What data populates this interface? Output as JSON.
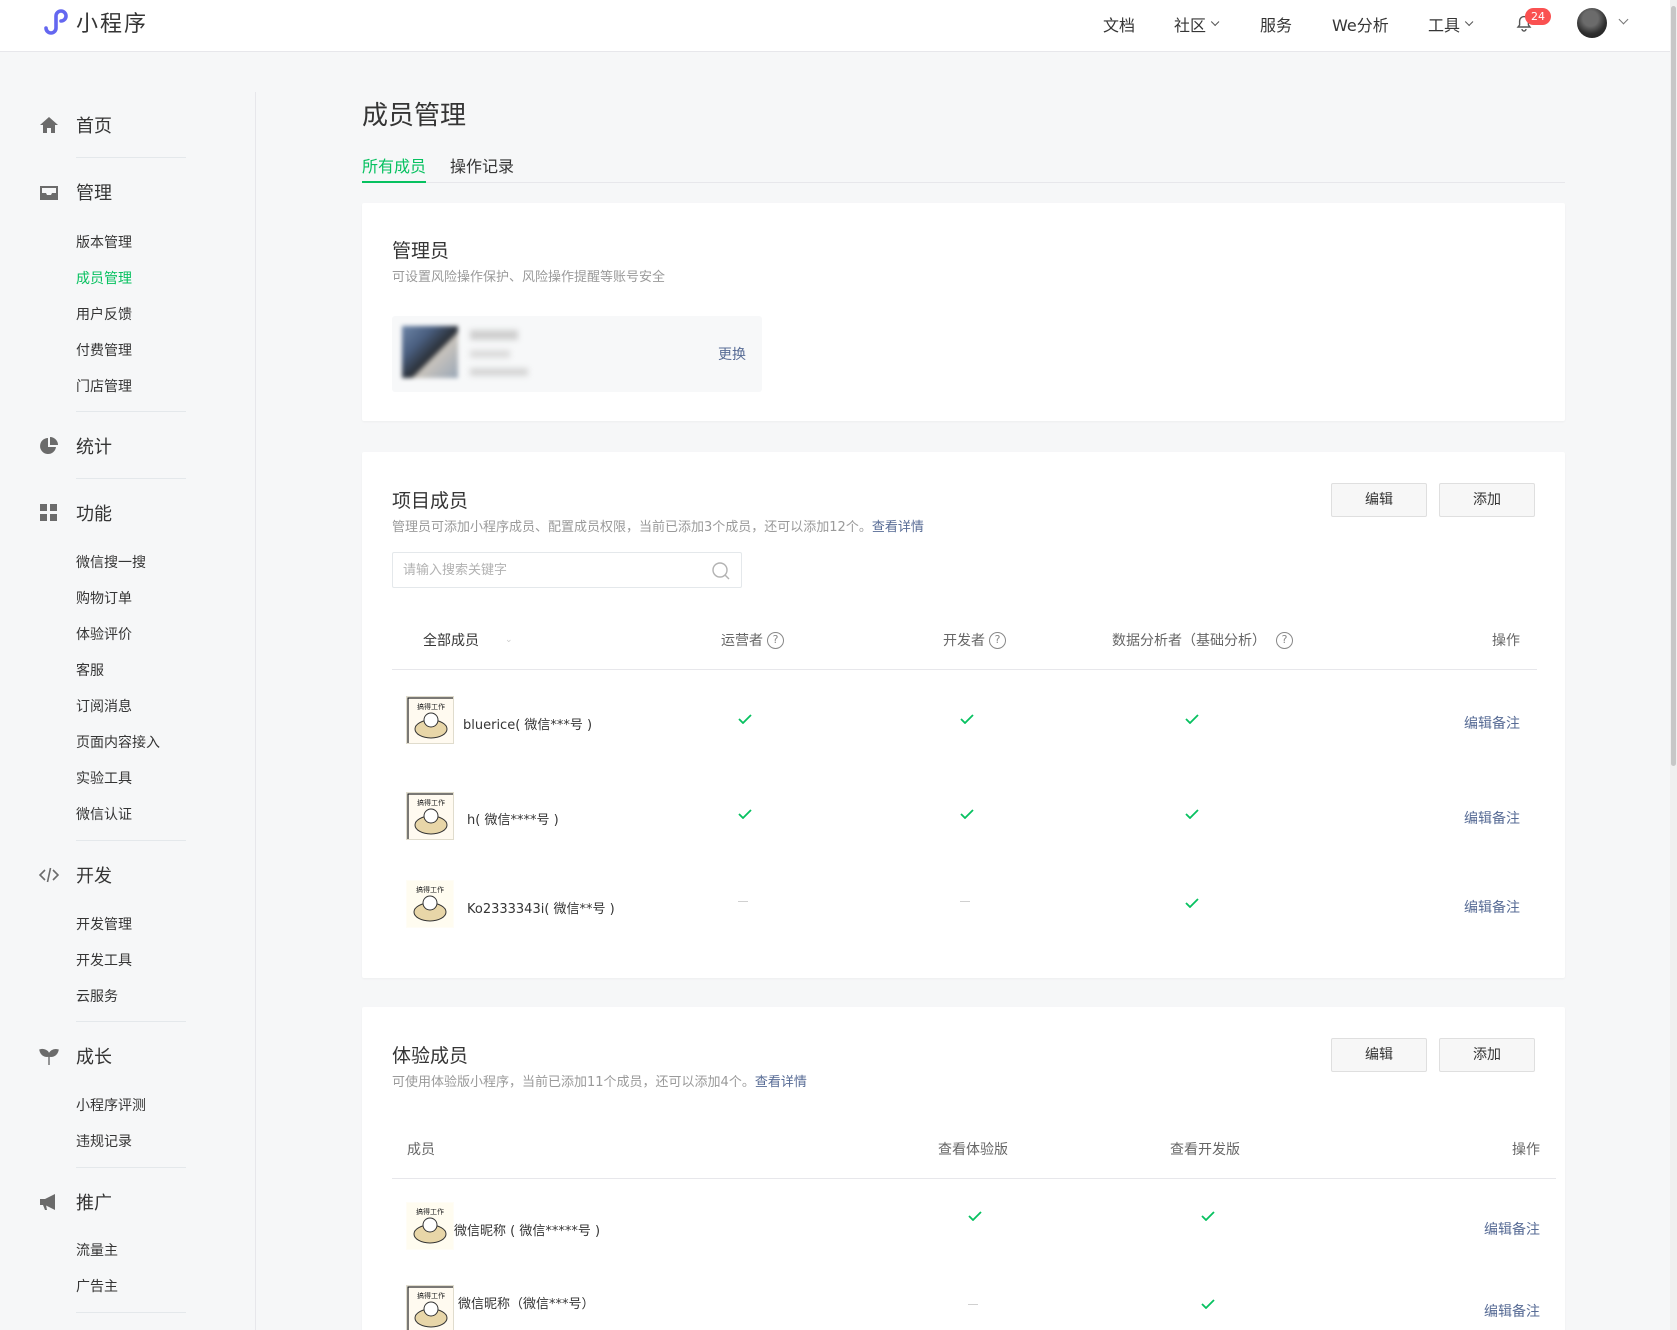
{
  "topbar": {
    "logo_text": "小程序",
    "nav": [
      {
        "label": "文档"
      },
      {
        "label": "社区"
      },
      {
        "label": "服务"
      },
      {
        "label": "We分析"
      },
      {
        "label": "工具"
      }
    ],
    "notification_count": "24"
  },
  "sidebar": {
    "sections": [
      {
        "label": "首页",
        "icon": "home-icon",
        "items": []
      },
      {
        "label": "管理",
        "icon": "inbox-icon",
        "items": [
          "版本管理",
          "成员管理",
          "用户反馈",
          "付费管理",
          "门店管理"
        ]
      },
      {
        "label": "统计",
        "icon": "pie-chart-icon",
        "items": []
      },
      {
        "label": "功能",
        "icon": "grid-icon",
        "items": [
          "微信搜一搜",
          "购物订单",
          "体验评价",
          "客服",
          "订阅消息",
          "页面内容接入",
          "实验工具",
          "微信认证"
        ]
      },
      {
        "label": "开发",
        "icon": "code-icon",
        "items": [
          "开发管理",
          "开发工具",
          "云服务"
        ]
      },
      {
        "label": "成长",
        "icon": "sprout-icon",
        "items": [
          "小程序评测",
          "违规记录"
        ]
      },
      {
        "label": "推广",
        "icon": "megaphone-icon",
        "items": [
          "流量主",
          "广告主"
        ]
      }
    ],
    "active_item": "成员管理"
  },
  "main": {
    "title": "成员管理",
    "tabs": [
      "所有成员",
      "操作记录"
    ],
    "admin": {
      "title": "管理员",
      "desc": "可设置风险操作保护、风险操作提醒等账号安全",
      "change_label": "更换"
    },
    "project": {
      "title": "项目成员",
      "desc": "管理员可添加小程序成员、配置成员权限，当前已添加3个成员，还可以添加12个。",
      "desc_link": "查看详情",
      "edit_label": "编辑",
      "add_label": "添加",
      "search_placeholder": "请输入搜索关键字",
      "columns": [
        "全部成员",
        "运营者",
        "开发者",
        "数据分析者（基础分析）",
        "操作"
      ],
      "rows": [
        {
          "name": "bluerice( 微信***号 )",
          "operator": true,
          "developer": true,
          "analyst": true,
          "action": "编辑备注"
        },
        {
          "name": "h( 微信****号 )",
          "operator": true,
          "developer": true,
          "analyst": true,
          "action": "编辑备注"
        },
        {
          "name": "Ko2333343i( 微信**号 )",
          "operator": false,
          "developer": false,
          "analyst": true,
          "action": "编辑备注"
        }
      ]
    },
    "experience": {
      "title": "体验成员",
      "desc": "可使用体验版小程序，当前已添加11个成员，还可以添加4个。",
      "desc_link": "查看详情",
      "edit_label": "编辑",
      "add_label": "添加",
      "columns": [
        "成员",
        "查看体验版",
        "查看开发版",
        "操作"
      ],
      "rows": [
        {
          "name": "微信昵称 ( 微信*****号 )",
          "trial": true,
          "dev": true,
          "action": "编辑备注"
        },
        {
          "name": "微信昵称（微信***号）",
          "trial": false,
          "dev": true,
          "action": "编辑备注"
        }
      ]
    }
  },
  "colors": {
    "accent_green": "#07c160",
    "link_blue": "#576b95",
    "badge_red": "#fa5151"
  }
}
